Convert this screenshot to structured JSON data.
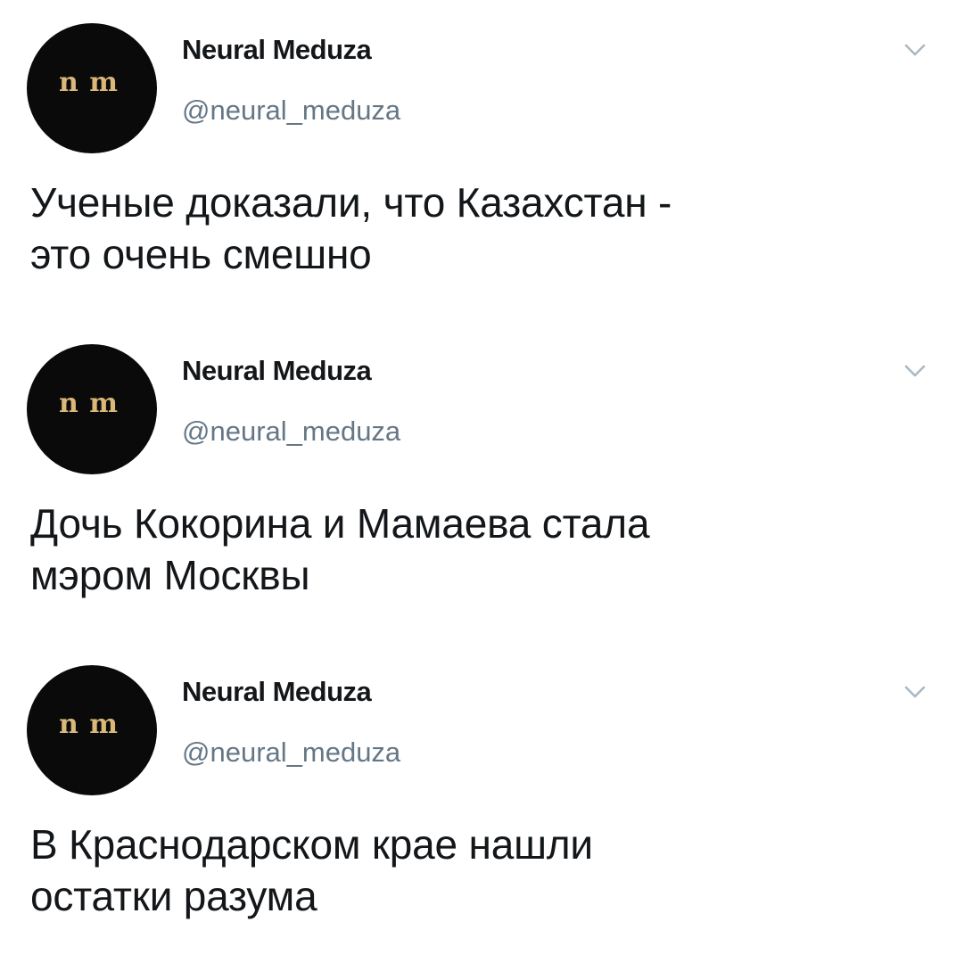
{
  "tweets": [
    {
      "author": {
        "display_name": "Neural Meduza",
        "handle": "@neural_meduza",
        "avatar_text": "n m"
      },
      "menu_icon": "chevron-down-icon",
      "text": "Ученые доказали, что Казахстан -\nэто очень смешно"
    },
    {
      "author": {
        "display_name": "Neural Meduza",
        "handle": "@neural_meduza",
        "avatar_text": "n m"
      },
      "menu_icon": "chevron-down-icon",
      "text": "Дочь Кокорина и Мамаева стала\nмэром Москвы"
    },
    {
      "author": {
        "display_name": "Neural Meduza",
        "handle": "@neural_meduza",
        "avatar_text": "n m"
      },
      "menu_icon": "chevron-down-icon",
      "text": "В Краснодарском крае нашли\nостатки разума"
    }
  ],
  "colors": {
    "text": "#14171a",
    "secondary": "#657786",
    "avatar_bg": "#0a0a0a",
    "avatar_logo": "#d9b87a",
    "chevron": "#aab8c2"
  }
}
